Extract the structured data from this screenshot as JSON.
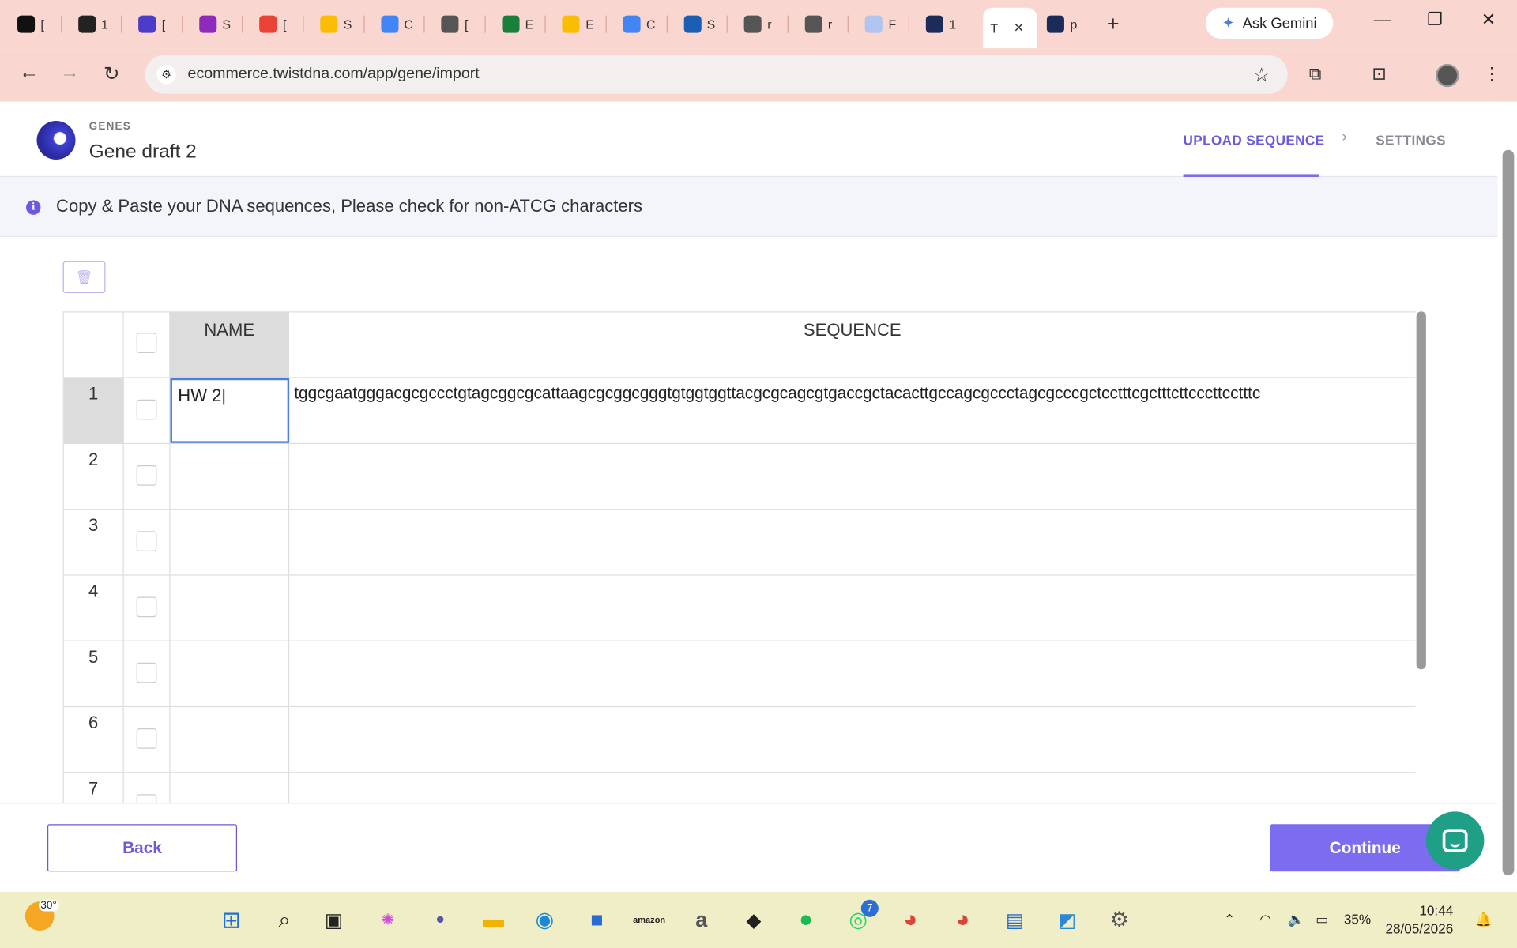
{
  "browser": {
    "tabs": [
      {
        "letter": "[",
        "color": "#111111"
      },
      {
        "letter": "1",
        "color": "#222222"
      },
      {
        "letter": "[",
        "color": "#4b3cc9"
      },
      {
        "letter": "S",
        "color": "#8e2bbd"
      },
      {
        "letter": "[",
        "color": "#ea4335"
      },
      {
        "letter": "S",
        "color": "#fbbc04"
      },
      {
        "letter": "C",
        "color": "#4285f4"
      },
      {
        "letter": "[",
        "color": "#555555"
      },
      {
        "letter": "E",
        "color": "#188038"
      },
      {
        "letter": "E",
        "color": "#fbbc04"
      },
      {
        "letter": "C",
        "color": "#4285f4"
      },
      {
        "letter": "S",
        "color": "#1a5fb4"
      },
      {
        "letter": "r",
        "color": "#555555"
      },
      {
        "letter": "r",
        "color": "#555555"
      },
      {
        "letter": "F",
        "color": "#b0c4f0"
      },
      {
        "letter": "1",
        "color": "#1b2c5a"
      },
      {
        "letter": "T",
        "color": "#ffffff"
      },
      {
        "letter": "p",
        "color": "#1b2c5a"
      }
    ],
    "active_tab_letter": "T",
    "ask_gemini": "Ask Gemini",
    "url": "ecommerce.twistdna.com/app/gene/import"
  },
  "header": {
    "section": "GENES",
    "title": "Gene draft 2",
    "steps": {
      "active": "UPLOAD SEQUENCE",
      "next": "SETTINGS"
    }
  },
  "info": {
    "icon": "info-icon",
    "text": "Copy & Paste your DNA sequences, Please check for non-ATCG characters"
  },
  "grid": {
    "headers": {
      "name": "NAME",
      "sequence": "SEQUENCE"
    },
    "rows": [
      {
        "num": "1",
        "name": "HW 2",
        "sequence": "tggcgaatgggacgcgccctgtagcggcgcattaagcgcggcgggtgtggtggttacgcgcagcgtgaccgctacacttgccagcgccctagcgcccgctcctttcgctttcttcccttcctttc"
      },
      {
        "num": "2",
        "name": "",
        "sequence": ""
      },
      {
        "num": "3",
        "name": "",
        "sequence": ""
      },
      {
        "num": "4",
        "name": "",
        "sequence": ""
      },
      {
        "num": "5",
        "name": "",
        "sequence": ""
      },
      {
        "num": "6",
        "name": "",
        "sequence": ""
      },
      {
        "num": "7",
        "name": "",
        "sequence": ""
      }
    ]
  },
  "footer": {
    "back": "Back",
    "continue": "Continue"
  },
  "accent": "#6a5ae0",
  "taskbar": {
    "weather_temp": "30°",
    "whatsapp_badge": "7",
    "battery": "35%",
    "time": "10:44",
    "date": "28/05/2026"
  }
}
